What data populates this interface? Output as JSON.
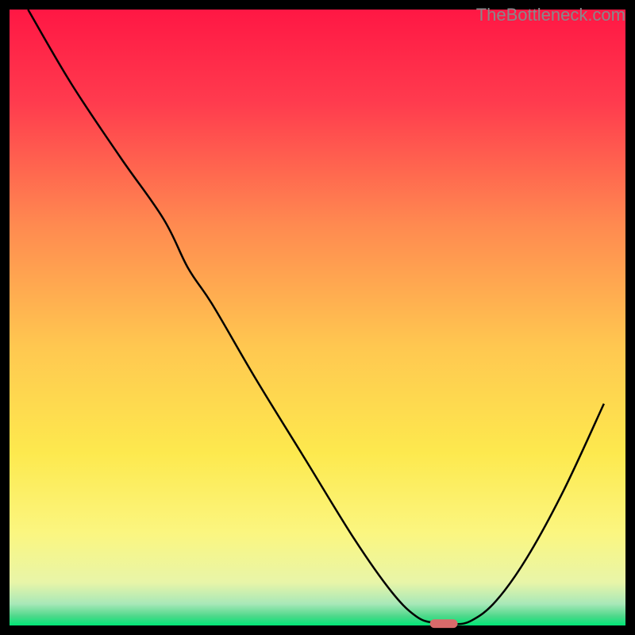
{
  "watermark": "TheBottleneck.com",
  "chart_data": {
    "type": "line",
    "title": "",
    "xlabel": "",
    "ylabel": "",
    "xlim": [
      0,
      100
    ],
    "ylim": [
      0,
      100
    ],
    "background": {
      "type": "vertical-gradient",
      "stops": [
        {
          "pos": 0.0,
          "color": "#ff1744"
        },
        {
          "pos": 0.15,
          "color": "#ff3b4e"
        },
        {
          "pos": 0.35,
          "color": "#ff8a50"
        },
        {
          "pos": 0.55,
          "color": "#ffc850"
        },
        {
          "pos": 0.72,
          "color": "#fde94e"
        },
        {
          "pos": 0.85,
          "color": "#fbf680"
        },
        {
          "pos": 0.93,
          "color": "#e8f5a8"
        },
        {
          "pos": 0.965,
          "color": "#a8e8b8"
        },
        {
          "pos": 0.985,
          "color": "#4dd88a"
        },
        {
          "pos": 1.0,
          "color": "#00e676"
        }
      ]
    },
    "series": [
      {
        "name": "bottleneck-curve",
        "type": "line",
        "color": "#000000",
        "width": 2.5,
        "x": [
          3.0,
          10.0,
          18.0,
          25.0,
          29.0,
          33.0,
          40.0,
          48.0,
          56.0,
          62.0,
          66.0,
          69.0,
          72.0,
          75.0,
          79.0,
          84.0,
          90.0,
          96.5
        ],
        "y": [
          100.0,
          88.0,
          76.0,
          66.0,
          58.0,
          52.0,
          40.0,
          27.0,
          14.0,
          5.5,
          1.5,
          0.4,
          0.2,
          0.8,
          4.0,
          11.0,
          22.0,
          36.0
        ]
      }
    ],
    "marker": {
      "name": "optimal-point",
      "shape": "rounded-rect",
      "x": 70.5,
      "y": 0.3,
      "width": 4.5,
      "height": 1.4,
      "color": "#d96a6a"
    },
    "border": {
      "color": "#000000",
      "width": 12
    }
  }
}
